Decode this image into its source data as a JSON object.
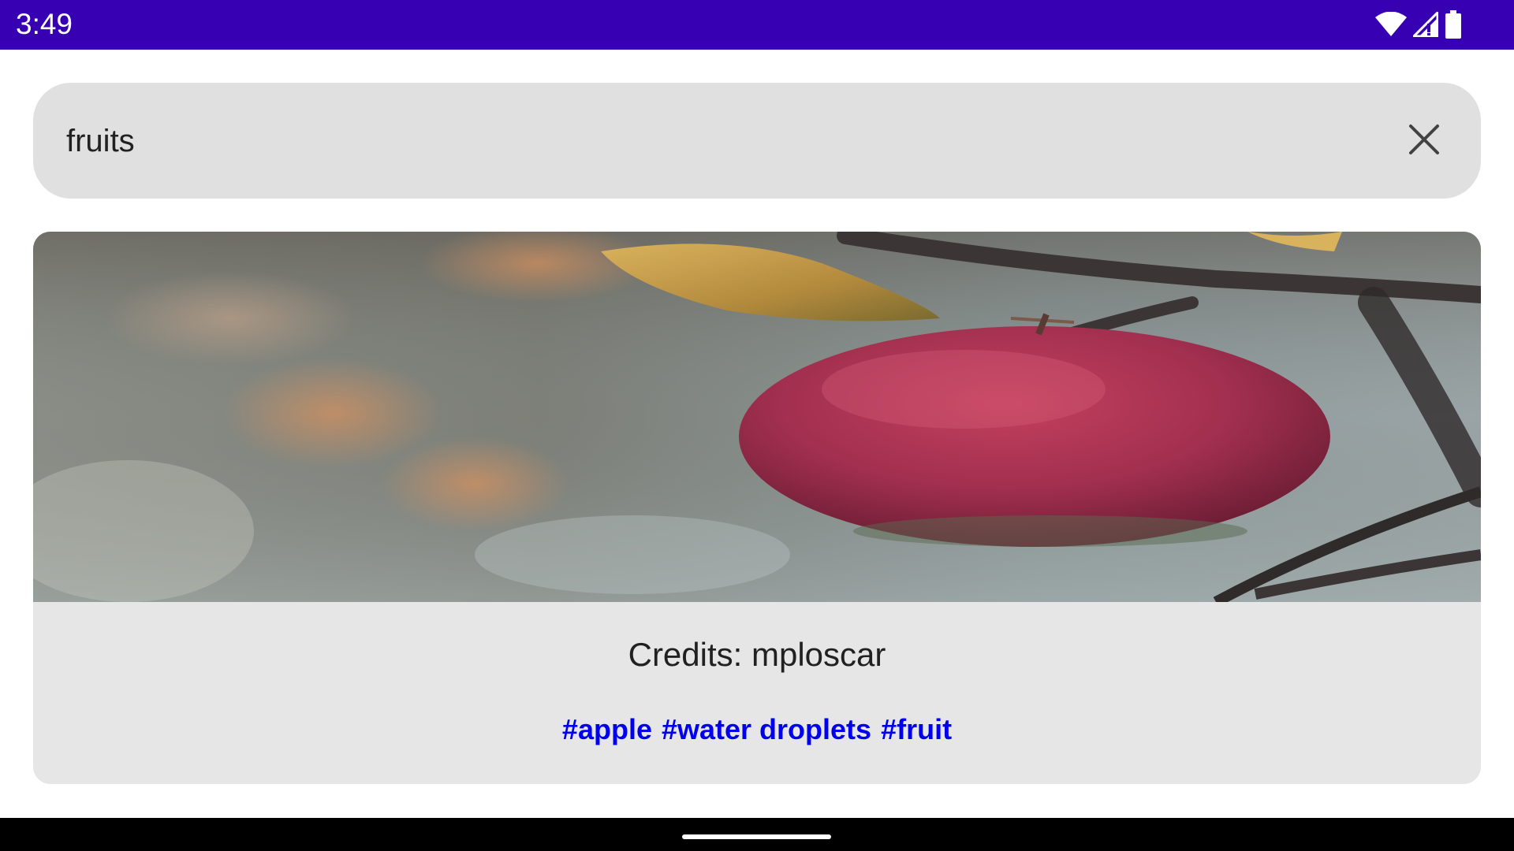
{
  "status_bar": {
    "time": "3:49",
    "background_color": "#3700b3",
    "icons": [
      "wifi-icon",
      "cellular-signal-icon",
      "battery-icon"
    ]
  },
  "search": {
    "value": "fruits",
    "clear_icon": "close-icon"
  },
  "result_card": {
    "image_description_icon": "apple-photo",
    "credits": "Credits: mploscar",
    "tags": [
      "#apple",
      "#water droplets",
      "#fruit"
    ],
    "tag_color": "#0000ee"
  },
  "navigation_bar": {
    "handle": "home-gesture-handle"
  }
}
